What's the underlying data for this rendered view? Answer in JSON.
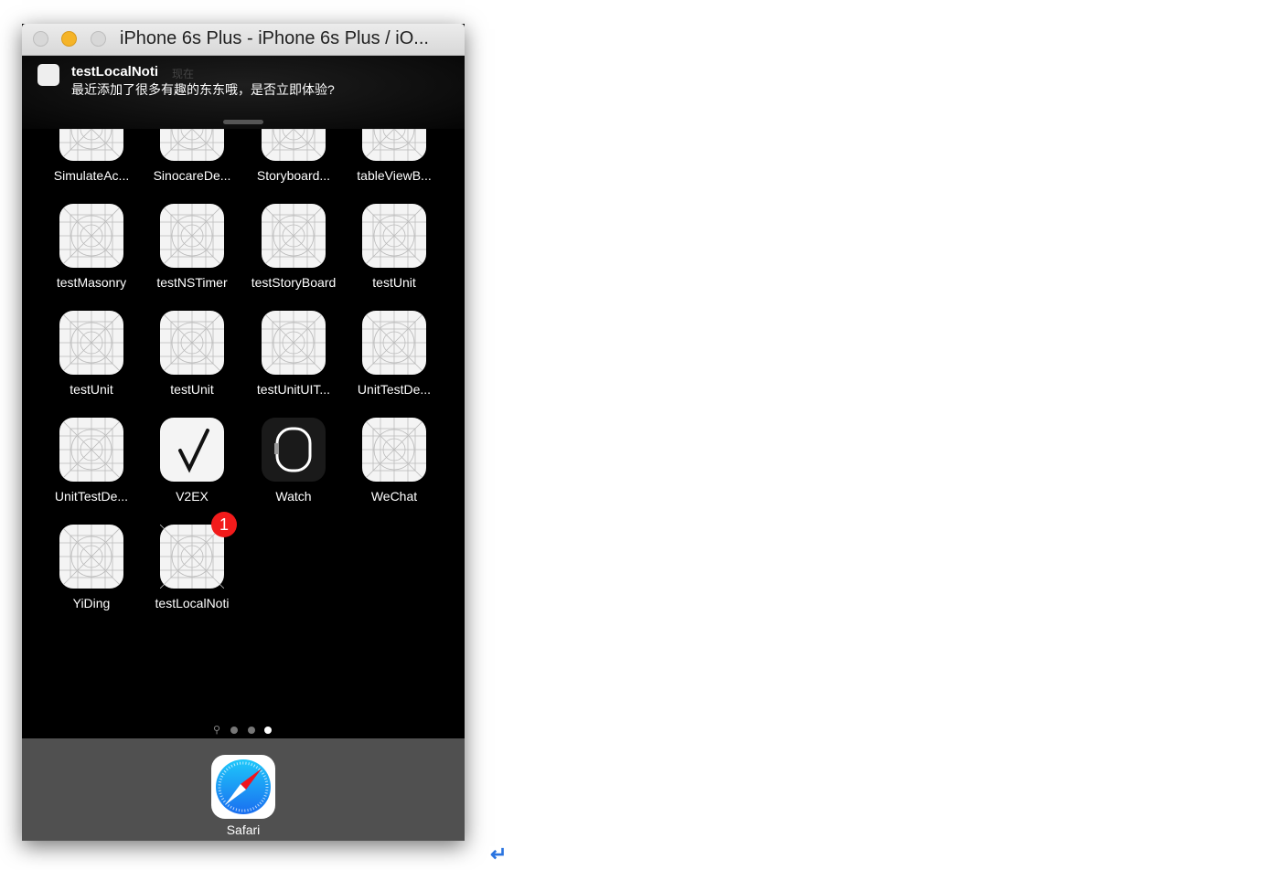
{
  "window": {
    "title": "iPhone 6s Plus - iPhone 6s Plus / iO..."
  },
  "notification": {
    "app": "testLocalNoti",
    "time": "现在",
    "message": "最近添加了很多有趣的东东哦，是否立即体验?"
  },
  "apps": [
    {
      "label": "SimulateAc..."
    },
    {
      "label": "SinocareDe..."
    },
    {
      "label": "Storyboard..."
    },
    {
      "label": "tableViewB..."
    },
    {
      "label": "testMasonry"
    },
    {
      "label": "testNSTimer"
    },
    {
      "label": "testStoryBoard"
    },
    {
      "label": "testUnit"
    },
    {
      "label": "testUnit"
    },
    {
      "label": "testUnit"
    },
    {
      "label": "testUnitUIT..."
    },
    {
      "label": "UnitTestDe..."
    },
    {
      "label": "UnitTestDe..."
    },
    {
      "label": "V2EX",
      "icon": "v2ex-icon"
    },
    {
      "label": "Watch",
      "icon": "watch-icon"
    },
    {
      "label": "WeChat"
    },
    {
      "label": "YiDing"
    },
    {
      "label": "testLocalNoti",
      "badge": "1"
    }
  ],
  "page_indicator": {
    "pages": 3,
    "current": 3
  },
  "dock": {
    "apps": [
      {
        "label": "Safari",
        "icon": "safari-icon"
      }
    ]
  },
  "colors": {
    "badge": "#f21b1b",
    "dock": "#505050",
    "minimize": "#f5b428"
  }
}
